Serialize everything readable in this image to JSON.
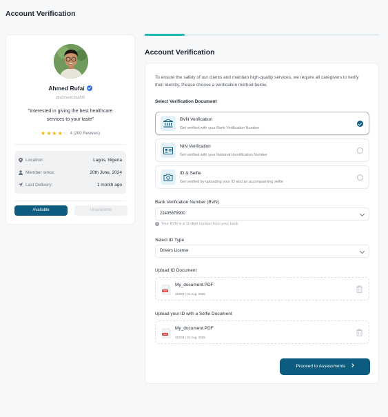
{
  "header": {
    "title": "Account Verification"
  },
  "profile": {
    "name": "Ahmed Rufai",
    "handle": "@ahmedrufai200",
    "quote": "\"Interested in giving the best healthcare services to your taste\"",
    "rating": {
      "value": 4,
      "max": 5,
      "score_text": "4",
      "reviews_text": "(200 Reviews)"
    },
    "info": [
      {
        "label": "Location:",
        "value": "Lagos, Nigeria",
        "icon": "location-pin-icon"
      },
      {
        "label": "Member since:",
        "value": "20th June, 2024",
        "icon": "user-icon"
      },
      {
        "label": "Last Delivery:",
        "value": "1 month ago",
        "icon": "send-icon"
      }
    ],
    "available_label": "Available",
    "unavailable_label": "Unavailable"
  },
  "progress": {
    "fraction": 0.17
  },
  "form": {
    "title": "Account Verification",
    "intro": "To ensure the safety of our clients and maintain high-quality services, we require all caregivers to verify their identity. Please choose a verification method below.",
    "doc_label": "Select Verification Document",
    "options": [
      {
        "title": "BVN Verification",
        "subtitle": "Get verified with your Bank Verification Number",
        "icon": "bank-icon",
        "selected": true
      },
      {
        "title": "NIN Verification",
        "subtitle": "Get verified with your National Identification Number",
        "icon": "id-card-icon",
        "selected": false
      },
      {
        "title": "ID & Selfie",
        "subtitle": "Get verified by uploading your ID and an accompanying selfie",
        "icon": "camera-icon",
        "selected": false
      }
    ],
    "bvn_label": "Bank Verification Number (BVN)",
    "bvn_value": "22405678900",
    "bvn_hint": "Your BVN is a 11-digit number from your bank",
    "id_type_label": "Select ID Type",
    "id_type_value": "Drivers License",
    "upload_id_label": "Upload ID Document",
    "upload_id": {
      "name": "My_document.PDF",
      "size": "310KB",
      "sep": "|",
      "date": "31 Aug, 2025"
    },
    "upload_selfie_label": "Upload your ID with a Selfie Document",
    "upload_selfie": {
      "name": "My_document.PDF",
      "size": "310KB",
      "sep": "|",
      "date": "31 Aug, 2025"
    },
    "proceed_label": "Proceed to Assessments"
  },
  "colors": {
    "primary": "#0b5c7e",
    "progress": "#20b8b0",
    "star": "#f5b301",
    "verified": "#2f6fe0"
  }
}
